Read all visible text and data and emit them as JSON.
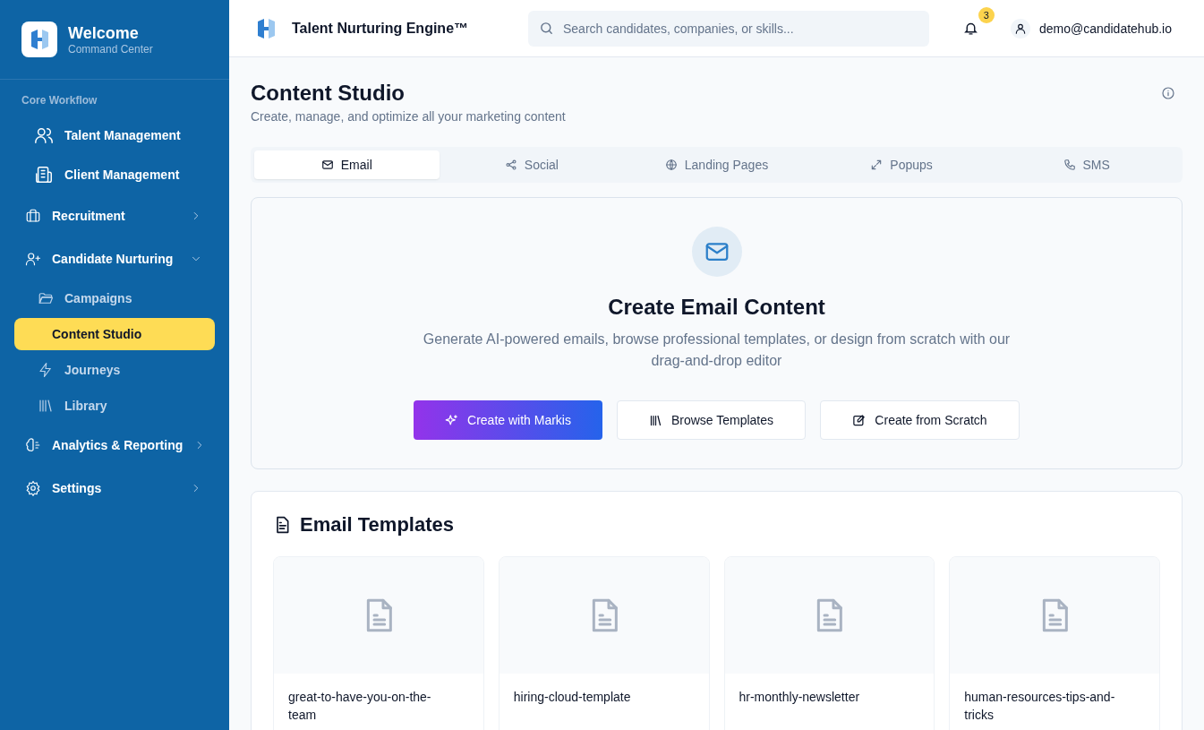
{
  "sidebar": {
    "title": "Welcome",
    "subtitle": "Command Center",
    "section_label": "Core Workflow",
    "items": [
      {
        "kind": "link",
        "label": "Talent Management",
        "selected": false
      },
      {
        "kind": "link",
        "label": "Client Management",
        "selected": false
      },
      {
        "kind": "group",
        "label": "Recruitment",
        "expanded": false
      },
      {
        "kind": "group",
        "label": "Candidate Nurturing",
        "expanded": true,
        "children": [
          {
            "label": "Campaigns",
            "selected": false
          },
          {
            "label": "Content Studio",
            "selected": true
          },
          {
            "label": "Journeys",
            "selected": false
          },
          {
            "label": "Library",
            "selected": false
          }
        ]
      },
      {
        "kind": "group",
        "label": "Analytics & Reporting",
        "expanded": false
      },
      {
        "kind": "group",
        "label": "Settings",
        "expanded": false
      }
    ]
  },
  "header": {
    "app_title": "Talent Nurturing Engine™",
    "search": {
      "placeholder": "Search candidates, companies, or skills..."
    },
    "notification_count": "3",
    "user": "demo@candidatehub.io"
  },
  "page": {
    "title": "Content Studio",
    "subtitle": "Create, manage, and optimize all your marketing content"
  },
  "tabs": [
    {
      "label": "Email",
      "selected": true
    },
    {
      "label": "Social",
      "selected": false
    },
    {
      "label": "Landing Pages",
      "selected": false
    },
    {
      "label": "Popups",
      "selected": false
    },
    {
      "label": "SMS",
      "selected": false
    }
  ],
  "create_panel": {
    "title": "Create Email Content",
    "description": "Generate AI-powered emails, browse professional templates, or design from scratch with our drag-and-drop editor",
    "buttons": [
      {
        "kind": "primary",
        "label": "Create with Markis"
      },
      {
        "kind": "secondary",
        "label": "Browse Templates"
      },
      {
        "kind": "secondary",
        "label": "Create from Scratch"
      }
    ]
  },
  "templates": {
    "title": "Email Templates",
    "items": [
      {
        "name": "great-to-have-you-on-the-team"
      },
      {
        "name": "hiring-cloud-template"
      },
      {
        "name": "hr-monthly-newsletter"
      },
      {
        "name": "human-resources-tips-and-tricks"
      }
    ]
  }
}
